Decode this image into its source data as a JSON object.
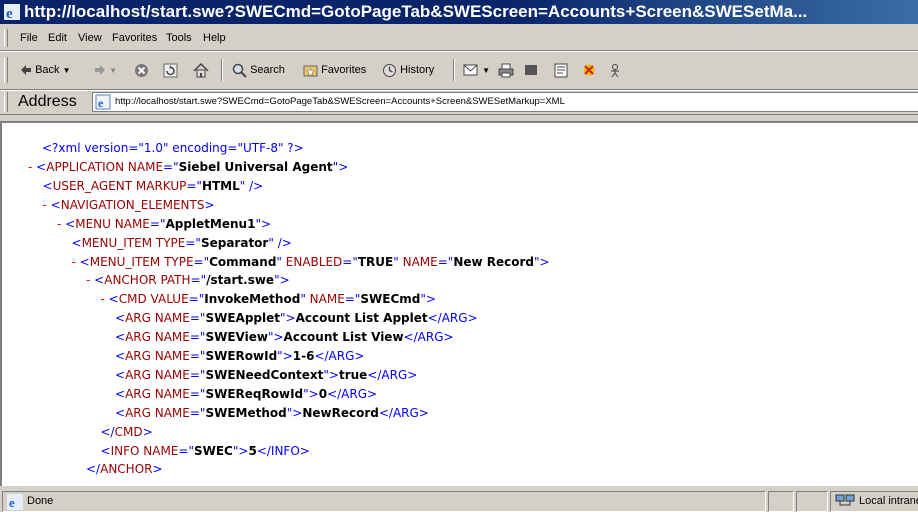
{
  "window": {
    "title": "http://localhost/start.swe?SWECmd=GotoPageTab&SWEScreen=Accounts+Screen&SWESetMa..."
  },
  "menubar": {
    "items": [
      "File",
      "Edit",
      "View",
      "Favorites",
      "Tools",
      "Help"
    ]
  },
  "toolbar": {
    "back_label": "Back",
    "search_label": "Search",
    "favorites_label": "Favorites",
    "history_label": "History"
  },
  "address": {
    "label": "Address",
    "url": "http://localhost/start.swe?SWECmd=GotoPageTab&SWEScreen=Accounts+Screen&SWESetMarkup=XML"
  },
  "xml": {
    "declaration": "<?xml version=\"1.0\" encoding=\"UTF-8\" ?>",
    "lines": [
      {
        "minus": "-",
        "open": "<",
        "tag": "APPLICATION",
        "attrs": [
          {
            "name": "NAME",
            "value": "Siebel Universal Agent"
          }
        ],
        "close": ">",
        "text": "",
        "end": ""
      },
      {
        "minus": "",
        "open": "<",
        "tag": "USER_AGENT",
        "attrs": [
          {
            "name": "MARKUP",
            "value": "HTML"
          }
        ],
        "close": " />",
        "text": "",
        "end": ""
      },
      {
        "minus": "-",
        "open": "<",
        "tag": "NAVIGATION_ELEMENTS",
        "attrs": [],
        "close": ">",
        "text": "",
        "end": ""
      },
      {
        "minus": "-",
        "open": "<",
        "tag": "MENU",
        "attrs": [
          {
            "name": "NAME",
            "value": "AppletMenu1"
          }
        ],
        "close": ">",
        "text": "",
        "end": ""
      },
      {
        "minus": "",
        "open": "<",
        "tag": "MENU_ITEM",
        "attrs": [
          {
            "name": "TYPE",
            "value": "Separator"
          }
        ],
        "close": " />",
        "text": "",
        "end": ""
      },
      {
        "minus": "-",
        "open": "<",
        "tag": "MENU_ITEM",
        "attrs": [
          {
            "name": "TYPE",
            "value": "Command"
          },
          {
            "name": "ENABLED",
            "value": "TRUE"
          },
          {
            "name": "NAME",
            "value": "New Record"
          }
        ],
        "close": ">",
        "text": "",
        "end": ""
      },
      {
        "minus": "-",
        "open": "<",
        "tag": "ANCHOR",
        "attrs": [
          {
            "name": "PATH",
            "value": "/start.swe"
          }
        ],
        "close": ">",
        "text": "",
        "end": ""
      },
      {
        "minus": "-",
        "open": "<",
        "tag": "CMD",
        "attrs": [
          {
            "name": "VALUE",
            "value": "InvokeMethod"
          },
          {
            "name": "NAME",
            "value": "SWECmd"
          }
        ],
        "close": ">",
        "text": "",
        "end": ""
      },
      {
        "minus": "",
        "open": "<",
        "tag": "ARG",
        "attrs": [
          {
            "name": "NAME",
            "value": "SWEApplet"
          }
        ],
        "close": ">",
        "text": "Account List Applet",
        "end": "</ARG>"
      },
      {
        "minus": "",
        "open": "<",
        "tag": "ARG",
        "attrs": [
          {
            "name": "NAME",
            "value": "SWEView"
          }
        ],
        "close": ">",
        "text": "Account List View",
        "end": "</ARG>"
      },
      {
        "minus": "",
        "open": "<",
        "tag": "ARG",
        "attrs": [
          {
            "name": "NAME",
            "value": "SWERowId"
          }
        ],
        "close": ">",
        "text": "1-6",
        "end": "</ARG>"
      },
      {
        "minus": "",
        "open": "<",
        "tag": "ARG",
        "attrs": [
          {
            "name": "NAME",
            "value": "SWENeedContext"
          }
        ],
        "close": ">",
        "text": "true",
        "end": "</ARG>"
      },
      {
        "minus": "",
        "open": "<",
        "tag": "ARG",
        "attrs": [
          {
            "name": "NAME",
            "value": "SWEReqRowId"
          }
        ],
        "close": ">",
        "text": "0",
        "end": "</ARG>"
      },
      {
        "minus": "",
        "open": "<",
        "tag": "ARG",
        "attrs": [
          {
            "name": "NAME",
            "value": "SWEMethod"
          }
        ],
        "close": ">",
        "text": "NewRecord",
        "end": "</ARG>"
      },
      {
        "minus": "",
        "open": "</",
        "tag": "CMD",
        "attrs": [],
        "close": ">",
        "text": "",
        "end": ""
      },
      {
        "minus": "",
        "open": "<",
        "tag": "INFO",
        "attrs": [
          {
            "name": "NAME",
            "value": "SWEC"
          }
        ],
        "close": ">",
        "text": "5",
        "end": "</INFO>"
      },
      {
        "minus": "",
        "open": "</",
        "tag": "ANCHOR",
        "attrs": [],
        "close": ">",
        "text": "",
        "end": ""
      }
    ]
  },
  "status": {
    "text": "Done",
    "zone": "Local intranet"
  }
}
